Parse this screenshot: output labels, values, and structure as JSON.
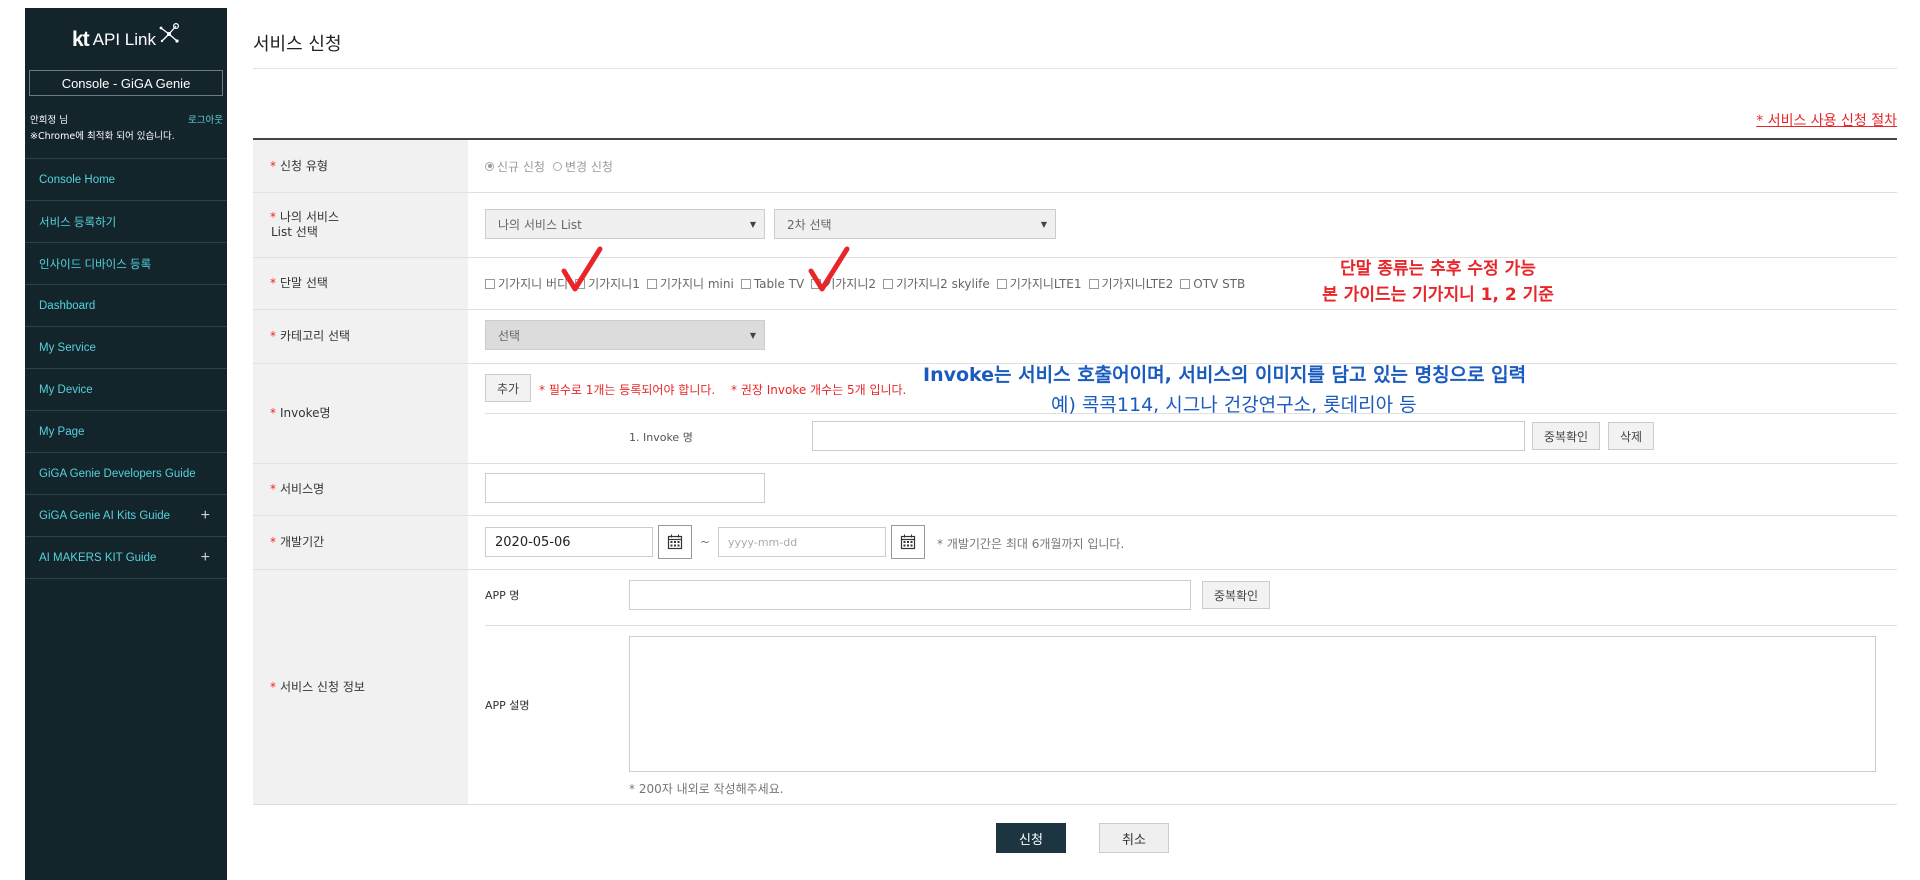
{
  "sidebar": {
    "logo_kt": "kt",
    "logo_text": "API Link",
    "console_label": "Console - GiGA Genie",
    "user_name": "안희정 님",
    "logout": "로그아웃",
    "chrome_note": "※Chrome에 최적화 되어 있습니다.",
    "items": [
      {
        "label": "Console Home"
      },
      {
        "label": "서비스 등록하기"
      },
      {
        "label": "인사이드 디바이스 등록"
      },
      {
        "label": "Dashboard"
      },
      {
        "label": "My Service"
      },
      {
        "label": "My Device"
      },
      {
        "label": "My Page"
      },
      {
        "label": "GiGA Genie Developers Guide"
      },
      {
        "label": "GiGA Genie AI Kits Guide",
        "plus": "+"
      },
      {
        "label": "AI MAKERS KIT Guide",
        "plus": "+"
      }
    ]
  },
  "main": {
    "page_title": "서비스 신청",
    "procedure_link": "* 서비스 사용 신청 절차",
    "required_mark": "*",
    "apply_type": {
      "label": "신청 유형",
      "options": [
        "신규 신청",
        "변경 신청"
      ],
      "selected": "신규 신청"
    },
    "my_service": {
      "label_line1": "나의 서비스",
      "label_line2": "List 선택",
      "select1": "나의 서비스 List",
      "select2": "2차 선택"
    },
    "device": {
      "label": "단말 선택",
      "options": [
        "기가지니 버디",
        "기가지니1",
        "기가지니 mini",
        "Table TV",
        "기가지니2",
        "기가지니2 skylife",
        "기가지니LTE1",
        "기가지니LTE2",
        "OTV STB"
      ]
    },
    "category": {
      "label": "카테고리 선택",
      "select": "선택"
    },
    "invoke": {
      "label": "Invoke명",
      "add_button": "추가",
      "note_required": "* 필수로 1개는 등록되어야 합니다.",
      "note_recommend": "* 권장 Invoke 개수는 5개 입니다.",
      "row_label": "1. Invoke 명",
      "dup_check": "중복확인",
      "delete": "삭제"
    },
    "service_name": {
      "label": "서비스명"
    },
    "dev_period": {
      "label": "개발기간",
      "start": "2020-05-06",
      "separator": "~",
      "end_placeholder": "yyyy-mm-dd",
      "note": "* 개발기간은 최대 6개월까지 입니다."
    },
    "service_info": {
      "label": "서비스 신청 정보",
      "app_name_label": "APP 명",
      "app_dup_check": "중복확인",
      "app_desc_label": "APP 설명",
      "desc_note": "* 200자 내외로 작성해주세요."
    },
    "submit": "신청",
    "cancel": "취소"
  },
  "annotations": {
    "device_note_line1": "단말 종류는 추후 수정 가능",
    "device_note_line2": "본 가이드는 기가지니 1, 2 기준",
    "invoke_note_line1": "Invoke는 서비스 호출어이며, 서비스의 이미지를 담고 있는 명칭으로 입력",
    "invoke_note_line2": "예) 콕콕114, 시그나 건강연구소, 롯데리아 등"
  },
  "colors": {
    "sidebar_bg": "#13242b",
    "sidebar_link": "#55d3dd",
    "required_red": "#e8262a",
    "annotation_blue": "#1a5bbf",
    "submit_bg": "#1d3540"
  }
}
